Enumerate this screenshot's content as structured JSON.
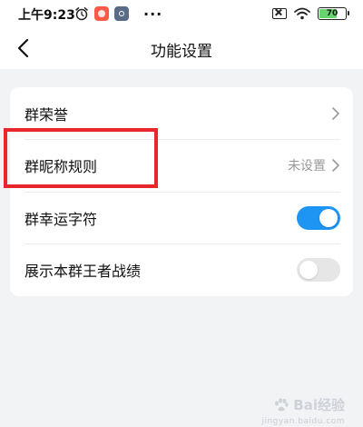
{
  "status_bar": {
    "time": "上午9:23",
    "more": "···",
    "battery": "70",
    "battery_level_percent": 70,
    "icons": [
      "alarm-icon",
      "app-notification-icon",
      "app-notification-icon-2",
      "sim-off-icon",
      "wifi-icon",
      "battery-icon"
    ]
  },
  "header": {
    "title": "功能设置",
    "back_icon": "chevron-left-icon"
  },
  "settings": {
    "items": [
      {
        "label": "群荣誉",
        "type": "link"
      },
      {
        "label": "群昵称规则",
        "value": "未设置",
        "type": "link",
        "highlighted": true
      },
      {
        "label": "群幸运字符",
        "type": "toggle",
        "enabled": true
      },
      {
        "label": "展示本群王者战绩",
        "type": "toggle",
        "enabled": false
      }
    ]
  },
  "watermark": {
    "text": "Bai经验",
    "subtext": "jingyan.baidu.com"
  },
  "colors": {
    "accent": "#1e95f2",
    "highlight": "#e8262c",
    "background": "#f2f3f5",
    "toggle_off": "#e6e6e6"
  }
}
